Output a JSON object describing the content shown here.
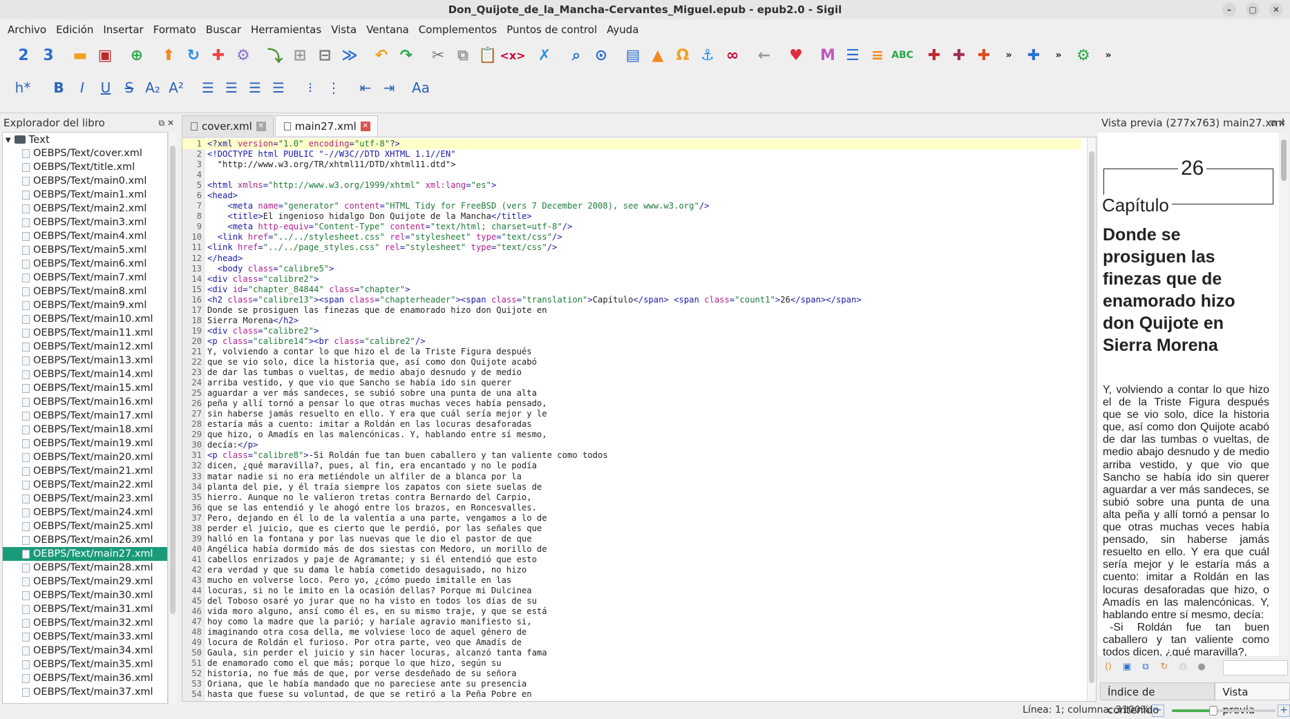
{
  "window": {
    "title": "Don_Quijote_de_la_Mancha-Cervantes_Miguel.epub - epub2.0 - Sigil"
  },
  "menu": [
    "Archivo",
    "Edición",
    "Insertar",
    "Formato",
    "Buscar",
    "Herramientas",
    "Vista",
    "Ventana",
    "Complementos",
    "Puntos de control",
    "Ayuda"
  ],
  "toolbar2": {
    "heading": "h*",
    "bold": "B",
    "italic": "I",
    "underline": "U",
    "strike": "S",
    "subscript": "A₂",
    "superscript": "A²",
    "case": "Aa"
  },
  "book_browser": {
    "title": "Explorador del libro",
    "folder": "Text",
    "files": [
      "OEBPS/Text/cover.xml",
      "OEBPS/Text/title.xml",
      "OEBPS/Text/main0.xml",
      "OEBPS/Text/main1.xml",
      "OEBPS/Text/main2.xml",
      "OEBPS/Text/main3.xml",
      "OEBPS/Text/main4.xml",
      "OEBPS/Text/main5.xml",
      "OEBPS/Text/main6.xml",
      "OEBPS/Text/main7.xml",
      "OEBPS/Text/main8.xml",
      "OEBPS/Text/main9.xml",
      "OEBPS/Text/main10.xml",
      "OEBPS/Text/main11.xml",
      "OEBPS/Text/main12.xml",
      "OEBPS/Text/main13.xml",
      "OEBPS/Text/main14.xml",
      "OEBPS/Text/main15.xml",
      "OEBPS/Text/main16.xml",
      "OEBPS/Text/main17.xml",
      "OEBPS/Text/main18.xml",
      "OEBPS/Text/main19.xml",
      "OEBPS/Text/main20.xml",
      "OEBPS/Text/main21.xml",
      "OEBPS/Text/main22.xml",
      "OEBPS/Text/main23.xml",
      "OEBPS/Text/main24.xml",
      "OEBPS/Text/main25.xml",
      "OEBPS/Text/main26.xml",
      "OEBPS/Text/main27.xml",
      "OEBPS/Text/main28.xml",
      "OEBPS/Text/main29.xml",
      "OEBPS/Text/main30.xml",
      "OEBPS/Text/main31.xml",
      "OEBPS/Text/main32.xml",
      "OEBPS/Text/main33.xml",
      "OEBPS/Text/main34.xml",
      "OEBPS/Text/main35.xml",
      "OEBPS/Text/main36.xml",
      "OEBPS/Text/main37.xml"
    ],
    "selected": "OEBPS/Text/main27.xml"
  },
  "tabs": [
    {
      "label": "cover.xml",
      "active": false
    },
    {
      "label": "main27.xml",
      "active": true
    }
  ],
  "code_lines": [
    "<?xml version=\"1.0\" encoding=\"utf-8\"?>",
    "<!DOCTYPE html PUBLIC \"-//W3C//DTD XHTML 1.1//EN\"",
    "  \"http://www.w3.org/TR/xhtml11/DTD/xhtml11.dtd\">",
    "",
    "<html xmlns=\"http://www.w3.org/1999/xhtml\" xml:lang=\"es\">",
    "<head>",
    "    <meta name=\"generator\" content=\"HTML Tidy for FreeBSD (vers 7 December 2008), see www.w3.org\"/>",
    "    <title>El ingenioso hidalgo Don Quijote de la Mancha</title>",
    "    <meta http-equiv=\"Content-Type\" content=\"text/html; charset=utf-8\"/>",
    "  <link href=\"../../stylesheet.css\" rel=\"stylesheet\" type=\"text/css\"/>",
    "<link href=\"../../page_styles.css\" rel=\"stylesheet\" type=\"text/css\"/>",
    "</head>",
    "  <body class=\"calibre5\">",
    "<div class=\"calibre2\">",
    "<div id=\"chapter_84844\" class=\"chapter\">",
    "<h2 class=\"calibre13\"><span class=\"chapterheader\"><span class=\"translation\">Capítulo</span> <span class=\"count1\">26</span></span>",
    "Donde se prosiguen las finezas que de enamorado hizo don Quijote en",
    "Sierra Morena</h2>",
    "<div class=\"calibre2\">",
    "<p class=\"calibre14\"><br class=\"calibre2\"/>",
    "Y, volviendo a contar lo que hizo el de la Triste Figura después",
    "que se vio solo, dice la historia que, así como don Quijote acabó",
    "de dar las tumbas o vueltas, de medio abajo desnudo y de medio",
    "arriba vestido, y que vio que Sancho se había ido sin querer",
    "aguardar a ver más sandeces, se subió sobre una punta de una alta",
    "peña y allí tornó a pensar lo que otras muchas veces había pensado,",
    "sin haberse jamás resuelto en ello. Y era que cuál sería mejor y le",
    "estaría más a cuento: imitar a Roldán en las locuras desaforadas",
    "que hizo, o Amadís en las malencónicas. Y, hablando entre sí mesmo,",
    "decía:</p>",
    "<p class=\"calibre8\">-Si Roldán fue tan buen caballero y tan valiente como todos",
    "dicen, ¿qué maravilla?, pues, al fin, era encantado y no le podía",
    "matar nadie si no era metiéndole un alfiler de a blanca por la",
    "planta del pie, y él traía siempre los zapatos con siete suelas de",
    "hierro. Aunque no le valieron tretas contra Bernardo del Carpio,",
    "que se las entendió y le ahogó entre los brazos, en Roncesvalles.",
    "Pero, dejando en él lo de la valentía a una parte, vengamos a lo de",
    "perder el juicio, que es cierto que le perdió, por las señales que",
    "halló en la fontana y por las nuevas que le dio el pastor de que",
    "Angélica había dormido más de dos siestas con Medoro, un morillo de",
    "cabellos enrizados y paje de Agramante; y si él entendió que esto",
    "era verdad y que su dama le había cometido desaguisado, no hizo",
    "mucho en volverse loco. Pero yo, ¿cómo puedo imitalle en las",
    "locuras, si no le imito en la ocasión dellas? Porque mi Dulcinea",
    "del Toboso osaré yo jurar que no ha visto en todos los días de su",
    "vida moro alguno, ansí como él es, en su mismo traje, y que se está",
    "hoy como la madre que la parió; y haríale agravio manifiesto si,",
    "imaginando otra cosa della, me volviese loco de aquel género de",
    "locura de Roldán el furioso. Por otra parte, veo que Amadís de",
    "Gaula, sin perder el juicio y sin hacer locuras, alcanzó tanta fama",
    "de enamorado como el que más; porque lo que hizo, según su",
    "historia, no fue más de que, por verse desdeñado de su señora",
    "Oriana, que le había mandado que no pareciese ante su presencia",
    "hasta que fuese su voluntad, de que se retiró a la Peña Pobre en"
  ],
  "preview": {
    "title": "Vista previa (277x763) main27.xml",
    "chapter_number": "26",
    "chapter_label": "Capítulo",
    "chapter_title": "Donde se prosiguen las finezas que de enamorado hizo don Quijote en Sierra Morena",
    "para1": "Y, volviendo a contar lo que hizo el de la Triste Figura después que se vio solo, dice la historia que, así como don Quijote acabó de dar las tumbas o vueltas, de medio abajo desnudo y de medio arriba vestido, y que vio que Sancho se había ido sin querer aguardar a ver más sandeces, se subió sobre una punta de una alta peña y allí tornó a pensar lo que otras muchas veces había pensado, sin haberse jamás resuelto en ello. Y era que cuál sería mejor y le estaría más a cuento: imitar a Roldán en las locuras desaforadas que hizo, o Amadís en las malencónicas. Y, hablando entre sí mesmo, decía:",
    "para2": "-Si Roldán fue tan buen caballero y tan valiente como todos dicen, ¿qué maravilla?,"
  },
  "bottom_tabs": [
    "Índice de contenido",
    "Vista previa"
  ],
  "status": {
    "position": "Línea: 1; columna: 3",
    "zoom": "100%",
    "zoom_value": 0.4
  }
}
